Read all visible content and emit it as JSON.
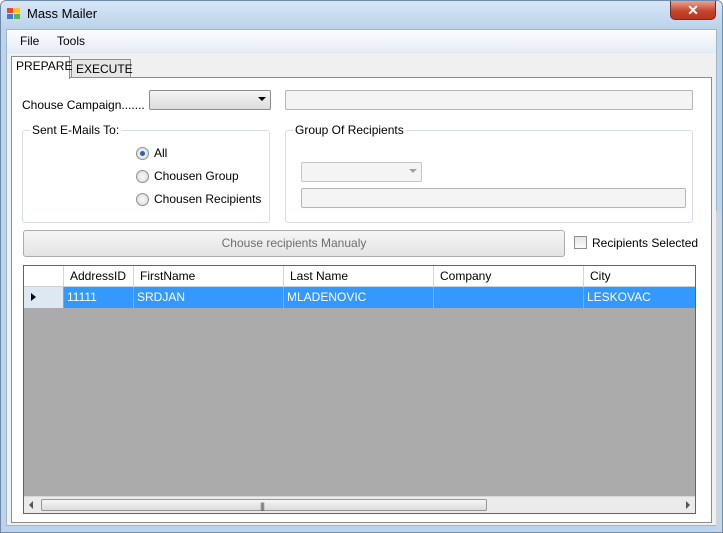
{
  "window": {
    "title": "Mass Mailer",
    "close_glyph": "✕"
  },
  "menu": {
    "items": [
      "File",
      "Tools"
    ]
  },
  "tabs": [
    {
      "label": "PREPARE",
      "active": true
    },
    {
      "label": "EXECUTE",
      "active": false
    }
  ],
  "prepare": {
    "campaign_label": "Chouse Campaign.......",
    "campaign_value": "",
    "campaign_info": "",
    "sent_to": {
      "title": "Sent E-Mails To:",
      "options": [
        {
          "label": "All",
          "checked": true
        },
        {
          "label": "Chousen Group",
          "checked": false
        },
        {
          "label": "Chousen Recipients",
          "checked": false
        }
      ]
    },
    "group": {
      "title": "Group Of Recipients",
      "combo_value": "",
      "text_value": ""
    },
    "manual_button": "Chouse recipients Manualy",
    "recipients_selected_label": "Recipients Selected",
    "recipients_selected_checked": false
  },
  "grid": {
    "columns": [
      "AddressID",
      "FirstName",
      "Last Name",
      "Company",
      "City"
    ],
    "rows": [
      {
        "AddressID": "11111",
        "FirstName": "SRDJAN",
        "Last Name": "MLADENOVIC",
        "Company": "",
        "City": "LESKOVAC",
        "selected": true
      }
    ],
    "scroll_grip": "|||"
  },
  "colors": {
    "selection": "#3399ff",
    "grid_background": "#ababab"
  }
}
